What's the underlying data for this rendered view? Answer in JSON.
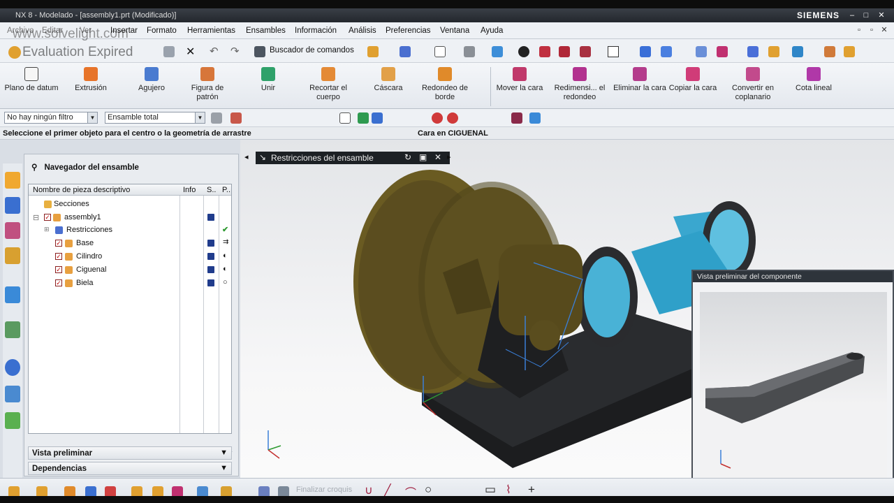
{
  "window": {
    "title": "NX 8 - Modelado - [assembly1.prt (Modificado)]",
    "brand": "SIEMENS"
  },
  "watermark": {
    "site": "www.solvelight.com",
    "notice": "Evaluation Expired"
  },
  "menus": [
    "Archivo",
    "Editar",
    "Ver",
    "Insertar",
    "Formato",
    "Herramientas",
    "Ensambles",
    "Información",
    "Análisis",
    "Preferencias",
    "Ventana",
    "Ayuda"
  ],
  "command_finder": "Buscador de comandos",
  "big_toolbar": [
    {
      "label": "Plano de datum",
      "color": "#f3f3f3"
    },
    {
      "label": "Extrusión",
      "color": "#e7742a"
    },
    {
      "label": "Agujero",
      "color": "#4a7bd0"
    },
    {
      "label": "Figura de patrón",
      "color": "#d7763a"
    },
    {
      "label": "Unir",
      "color": "#2fa16a"
    },
    {
      "label": "Recortar el cuerpo",
      "color": "#e48a36"
    },
    {
      "label": "Cáscara",
      "color": "#e2a048"
    },
    {
      "label": "Redondeo de borde",
      "color": "#e08a2a"
    },
    {
      "label": "Mover la cara",
      "color": "#c0396b"
    },
    {
      "label": "Redimensi... el redondeo",
      "color": "#b2328f"
    },
    {
      "label": "Eliminar la cara",
      "color": "#b43c8c"
    },
    {
      "label": "Copiar la cara",
      "color": "#d03c78"
    },
    {
      "label": "Convertir en coplanario",
      "color": "#c24a8c"
    },
    {
      "label": "Cota lineal",
      "color": "#b038a8"
    }
  ],
  "filter": {
    "type": "No hay ningún filtro",
    "scope": "Ensamble total"
  },
  "status": {
    "prompt": "Seleccione el primer objeto para el centro o la geometría de arrastre",
    "info": "Cara en CIGUENAL"
  },
  "navigator": {
    "title": "Navegador del ensamble",
    "columns": [
      "Nombre de pieza descriptivo",
      "Info",
      "S..",
      "P.."
    ],
    "rows": [
      {
        "name": "Secciones",
        "indent": 0
      },
      {
        "name": "assembly1",
        "indent": 0
      },
      {
        "name": "Restricciones",
        "indent": 1
      },
      {
        "name": "Base",
        "indent": 1
      },
      {
        "name": "Cilindro",
        "indent": 1
      },
      {
        "name": "Ciguenal",
        "indent": 1
      },
      {
        "name": "Biela",
        "indent": 1
      }
    ],
    "panels": [
      "Vista preliminar",
      "Dependencias"
    ]
  },
  "viewport_tab": "Restricciones del ensamble",
  "preview_title": "Vista preliminar del componente",
  "bottom": {
    "finish_sketch": "Finalizar croquis"
  }
}
